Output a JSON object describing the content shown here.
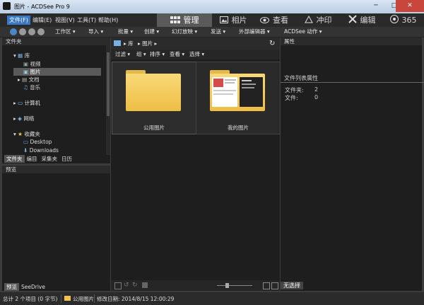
{
  "window": {
    "title": "图片 - ACDSee Pro 9",
    "controls": [
      "─",
      "□",
      "✕"
    ]
  },
  "menu": [
    "文件(F)",
    "编辑(E)",
    "视图(V)",
    "工具(T)",
    "帮助(H)"
  ],
  "modes": [
    {
      "label": "管理",
      "icon": "grid-icon"
    },
    {
      "label": "相片",
      "icon": "photo-icon"
    },
    {
      "label": "查看",
      "icon": "eye-icon"
    },
    {
      "label": "冲印",
      "icon": "develop-icon"
    },
    {
      "label": "编辑",
      "icon": "edit-icon"
    },
    {
      "label": "365",
      "icon": "acdsee365-icon"
    }
  ],
  "toolbar": [
    "工作区 ▾",
    "导入 ▾",
    "批量 ▾",
    "创建 ▾",
    "幻灯放映 ▾",
    "发送 ▾",
    "外部编辑器 ▾",
    "ACDSee 动作 ▾"
  ],
  "folders_panel": {
    "title": "文件夹",
    "tree": [
      {
        "label": "库",
        "level": 1,
        "expanded": true
      },
      {
        "label": "视频",
        "level": 2
      },
      {
        "label": "图片",
        "level": 2,
        "selected": true
      },
      {
        "label": "文档",
        "level": 2
      },
      {
        "label": "音乐",
        "level": 2
      },
      {
        "label": "计算机",
        "level": 1
      },
      {
        "label": "网络",
        "level": 1
      },
      {
        "label": "收藏夹",
        "level": 1,
        "expanded": true
      },
      {
        "label": "Desktop",
        "level": 2
      },
      {
        "label": "Downloads",
        "level": 2
      }
    ],
    "tabs": [
      "文件夹",
      "编目",
      "采集夹",
      "日历"
    ]
  },
  "preview_panel": {
    "title": "预览",
    "tabs": [
      "预览",
      "SeeDrive"
    ]
  },
  "path": [
    "库",
    "图片"
  ],
  "filterbar": [
    "过滤 ▾",
    "组 ▾",
    "排序 ▾",
    "查看 ▾",
    "选择 ▾"
  ],
  "items": [
    {
      "label": "公用图片",
      "selected": true,
      "has_thumbs": false
    },
    {
      "label": "我的图片",
      "selected": false,
      "has_thumbs": true
    }
  ],
  "properties": {
    "title": "属性",
    "section": "文件列表属性",
    "rows": [
      {
        "key": "文件夹:",
        "value": "2"
      },
      {
        "key": "文件:",
        "value": "0"
      }
    ],
    "tab": "无选择"
  },
  "status": {
    "summary": "总计 2 个项目 (0 字节)",
    "selected": "公用图片",
    "modified": "修改日期: 2014/8/15 12:00:29"
  },
  "colors": {
    "accent": "#3a78c4",
    "folder": "#f2c44f"
  }
}
